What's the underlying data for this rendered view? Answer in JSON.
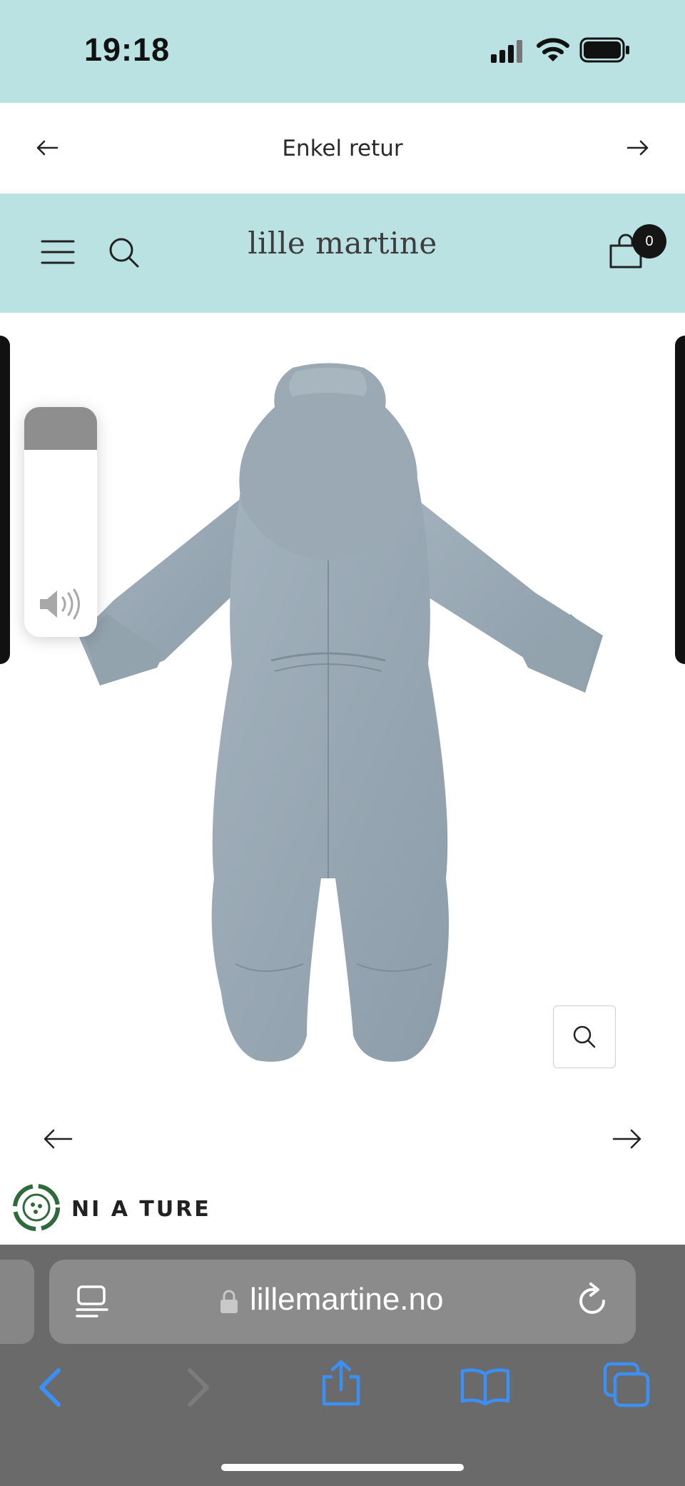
{
  "status_bar": {
    "time": "19:18"
  },
  "announcement": {
    "text": "Enkel retur"
  },
  "header": {
    "logo": "lille martine",
    "cart_count": "0"
  },
  "gallery": {
    "product_image_alt": "Baby snowsuit in dusty blue, back view",
    "brand_label": "NI A TURE"
  },
  "browser": {
    "url": "lillemartine.no"
  },
  "colors": {
    "header_bg": "#bae2e3",
    "suit": "#97a7b3",
    "browser_bg": "#6a6a6a",
    "ios_blue": "#3b8ff5"
  }
}
